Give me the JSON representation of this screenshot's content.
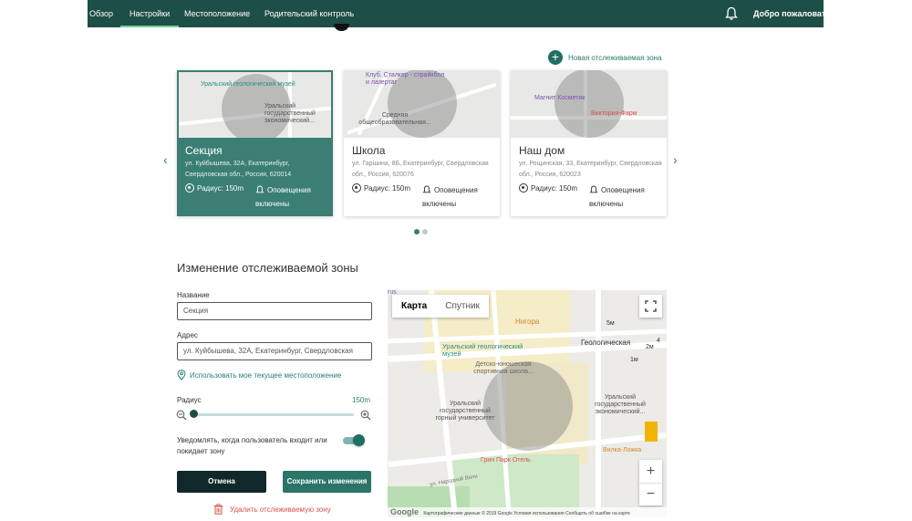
{
  "nav": {
    "items": [
      {
        "label": "Обзор"
      },
      {
        "label": "Настройки"
      },
      {
        "label": "Местоположение"
      },
      {
        "label": "Родительский контроль"
      }
    ],
    "welcome": "Добро пожаловать,"
  },
  "new_zone_label": "Новая отслеживаемая зона",
  "cards": [
    {
      "title": "Секция",
      "address": "ул. Куйбышева, 32А, Екатеринбург, Свердловская обл., Россия, 620014",
      "radius": "Радиус: 150m",
      "notify": "Оповещения включены",
      "map_labels": [
        "Уральский геологический музей",
        "Уральский государственный экономический..."
      ]
    },
    {
      "title": "Школа",
      "address": "ул. Гаршина, 8Б, Екатеринбург, Свердловская обл., Россия, 620076",
      "radius": "Радиус: 150m",
      "notify": "Оповещения включены",
      "map_labels": [
        "Клуб. Сталкер - страйкбол и лазертаг",
        "Средняя общеобразовательная..."
      ]
    },
    {
      "title": "Наш дом",
      "address": "ул. Рощинская, 33, Екатеринбург, Свердловская обл., Россия, 620023",
      "radius": "Радиус: 150m",
      "notify": "Оповещения включены",
      "map_labels": [
        "Магнит Косметик",
        "Виктория-Фарм"
      ]
    }
  ],
  "form": {
    "title": "Изменение отслеживаемой зоны",
    "name_label": "Название",
    "name_value": "Секция",
    "address_label": "Адрес",
    "address_value": "ул. Куйбышева, 32А, Екатеринбург, Свердловская",
    "use_location": "Использовать мое текущее местоположение",
    "radius_label": "Радиус",
    "radius_value": "150m",
    "radius_fraction": 0.01,
    "notify_text": "Уведомлять, когда пользователь входит или покидает зону",
    "notify_enabled": true,
    "cancel": "Отмена",
    "save": "Сохранить изменения",
    "delete": "Удалить отслеживаемую зону"
  },
  "map": {
    "type_map": "Карта",
    "type_sat": "Спутник",
    "labels": {
      "nigora": "Нигора",
      "geologicheskaya": "Геологическая",
      "museum": "Уральский геологический музей",
      "school": "Детско-юношеская спортивная школа...",
      "mining_uni": "Уральский государственный горный университет",
      "econ_uni": "Уральский государственный экономический...",
      "hotel": "Грин Парк Отель",
      "vilka": "Вилка-Ложка",
      "street": "ул. Народной Воли",
      "rus": "rus",
      "m5": "5м",
      "m2": "2м",
      "m4": "4",
      "m1": "1м"
    },
    "footer": "Картографические данные © 2019 Google    Условия использования    Сообщить об ошибке на карте",
    "google": "Google"
  },
  "colors": {
    "brand": "#1e4e48",
    "accent": "#3a7e74",
    "delete": "#d9534f"
  }
}
